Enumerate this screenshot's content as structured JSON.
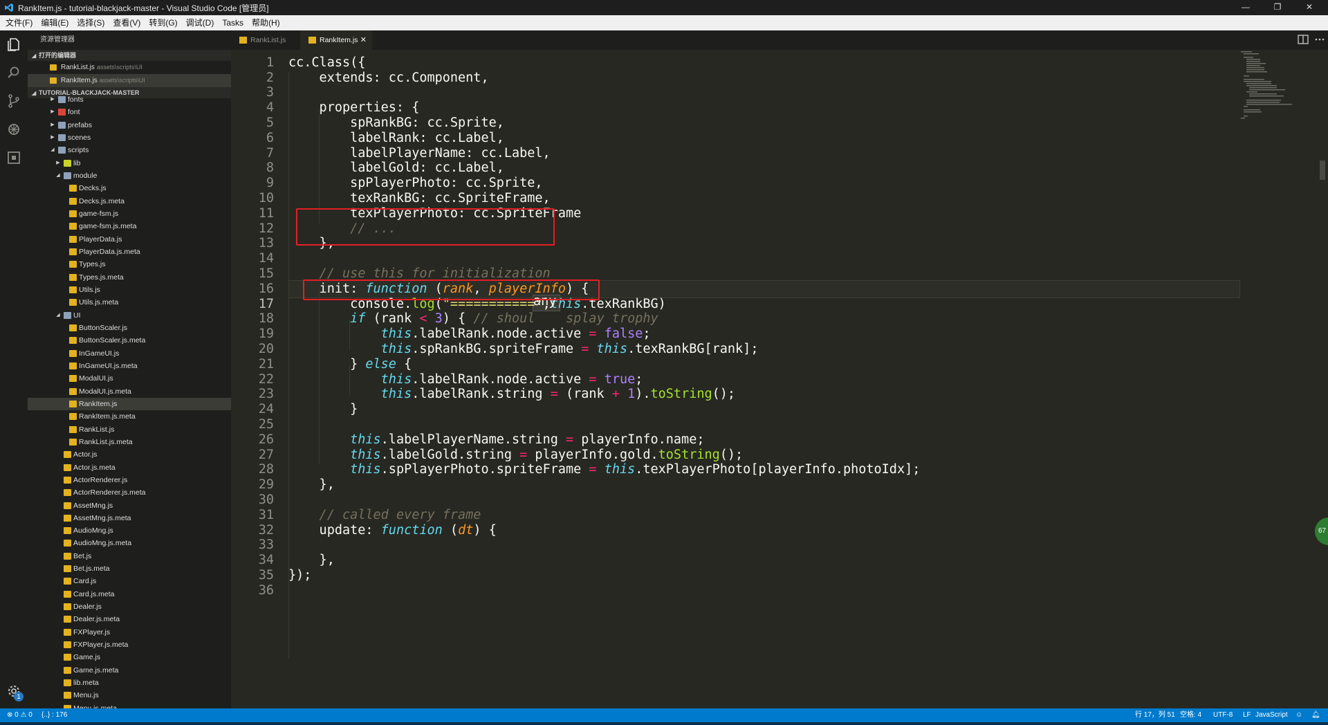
{
  "window": {
    "title": "RankItem.js - tutorial-blackjack-master - Visual Studio Code [管理员]",
    "controls": {
      "minimize": "—",
      "restore": "❐",
      "close": "✕"
    }
  },
  "menu": [
    "文件(F)",
    "编辑(E)",
    "选择(S)",
    "查看(V)",
    "转到(G)",
    "调试(D)",
    "Tasks",
    "帮助(H)"
  ],
  "activity_bar": {
    "icons": [
      "explorer-icon",
      "search-icon",
      "source-control-icon",
      "debug-icon",
      "extensions-icon",
      "settings-gear-icon"
    ],
    "settings_badge": "1"
  },
  "sidebar": {
    "title": "资源管理器",
    "open_editors_header": "打开的编辑器",
    "open_editors": [
      {
        "name": "RankList.js",
        "path": "assets\\scripts\\UI"
      },
      {
        "name": "RankItem.js",
        "path": "assets\\scripts\\UI"
      }
    ],
    "project_header": "TUTORIAL-BLACKJACK-MASTER",
    "tree": [
      {
        "label": "fonts",
        "type": "folder-partial",
        "depth": 2
      },
      {
        "label": "font",
        "type": "folder-red",
        "depth": 2
      },
      {
        "label": "prefabs",
        "type": "folder",
        "depth": 2
      },
      {
        "label": "scenes",
        "type": "folder",
        "depth": 2
      },
      {
        "label": "scripts",
        "type": "folder-open",
        "depth": 2
      },
      {
        "label": "lib",
        "type": "folder-lib",
        "depth": 3
      },
      {
        "label": "module",
        "type": "folder-open",
        "depth": 3
      },
      {
        "label": "Decks.js",
        "type": "js",
        "depth": 4
      },
      {
        "label": "Decks.js.meta",
        "type": "meta",
        "depth": 4
      },
      {
        "label": "game-fsm.js",
        "type": "js",
        "depth": 4
      },
      {
        "label": "game-fsm.js.meta",
        "type": "meta",
        "depth": 4
      },
      {
        "label": "PlayerData.js",
        "type": "js",
        "depth": 4
      },
      {
        "label": "PlayerData.js.meta",
        "type": "meta",
        "depth": 4
      },
      {
        "label": "Types.js",
        "type": "js",
        "depth": 4
      },
      {
        "label": "Types.js.meta",
        "type": "meta",
        "depth": 4
      },
      {
        "label": "Utils.js",
        "type": "js",
        "depth": 4
      },
      {
        "label": "Utils.js.meta",
        "type": "meta",
        "depth": 4
      },
      {
        "label": "UI",
        "type": "folder-open",
        "depth": 3
      },
      {
        "label": "ButtonScaler.js",
        "type": "js",
        "depth": 4
      },
      {
        "label": "ButtonScaler.js.meta",
        "type": "meta",
        "depth": 4
      },
      {
        "label": "InGameUI.js",
        "type": "js",
        "depth": 4
      },
      {
        "label": "InGameUI.js.meta",
        "type": "meta",
        "depth": 4
      },
      {
        "label": "ModalUI.js",
        "type": "js",
        "depth": 4
      },
      {
        "label": "ModalUI.js.meta",
        "type": "meta",
        "depth": 4
      },
      {
        "label": "RankItem.js",
        "type": "js",
        "depth": 4,
        "selected": true
      },
      {
        "label": "RankItem.js.meta",
        "type": "meta",
        "depth": 4
      },
      {
        "label": "RankList.js",
        "type": "js",
        "depth": 4
      },
      {
        "label": "RankList.js.meta",
        "type": "meta",
        "depth": 4
      },
      {
        "label": "Actor.js",
        "type": "js",
        "depth": 3
      },
      {
        "label": "Actor.js.meta",
        "type": "meta",
        "depth": 3
      },
      {
        "label": "ActorRenderer.js",
        "type": "js",
        "depth": 3
      },
      {
        "label": "ActorRenderer.js.meta",
        "type": "meta",
        "depth": 3
      },
      {
        "label": "AssetMng.js",
        "type": "js",
        "depth": 3
      },
      {
        "label": "AssetMng.js.meta",
        "type": "meta",
        "depth": 3
      },
      {
        "label": "AudioMng.js",
        "type": "js",
        "depth": 3
      },
      {
        "label": "AudioMng.js.meta",
        "type": "meta",
        "depth": 3
      },
      {
        "label": "Bet.js",
        "type": "js",
        "depth": 3
      },
      {
        "label": "Bet.js.meta",
        "type": "meta",
        "depth": 3
      },
      {
        "label": "Card.js",
        "type": "js",
        "depth": 3
      },
      {
        "label": "Card.js.meta",
        "type": "meta",
        "depth": 3
      },
      {
        "label": "Dealer.js",
        "type": "js",
        "depth": 3
      },
      {
        "label": "Dealer.js.meta",
        "type": "meta",
        "depth": 3
      },
      {
        "label": "FXPlayer.js",
        "type": "js",
        "depth": 3
      },
      {
        "label": "FXPlayer.js.meta",
        "type": "meta",
        "depth": 3
      },
      {
        "label": "Game.js",
        "type": "js",
        "depth": 3
      },
      {
        "label": "Game.js.meta",
        "type": "meta",
        "depth": 3
      },
      {
        "label": "lib.meta",
        "type": "meta",
        "depth": 3
      },
      {
        "label": "Menu.js",
        "type": "js",
        "depth": 3
      },
      {
        "label": "Menu.js.meta",
        "type": "meta",
        "depth": 3
      }
    ]
  },
  "tabs": [
    {
      "label": "RankList.js",
      "active": false
    },
    {
      "label": "RankItem.js",
      "active": true,
      "close": "✕"
    }
  ],
  "editor": {
    "current_line": 17,
    "hover_word": "any",
    "lines": [
      [
        [
          "",
          "cc.Class({"
        ]
      ],
      [
        [
          "",
          "    extends: cc.Component,"
        ]
      ],
      [
        [
          "",
          ""
        ]
      ],
      [
        [
          "",
          "    properties: {"
        ]
      ],
      [
        [
          "",
          "        spRankBG: cc.Sprite,"
        ]
      ],
      [
        [
          "",
          "        labelRank: cc.Label,"
        ]
      ],
      [
        [
          "",
          "        labelPlayerName: cc.Label,"
        ]
      ],
      [
        [
          "",
          "        labelGold: cc.Label,"
        ]
      ],
      [
        [
          "",
          "        spPlayerPhoto: cc.Sprite,"
        ]
      ],
      [
        [
          "",
          "        texRankBG: cc.SpriteFrame,"
        ]
      ],
      [
        [
          "",
          "        texPlayerPhoto: cc.SpriteFrame"
        ]
      ],
      [
        [
          "c",
          "        // ..."
        ]
      ],
      [
        [
          "",
          "    },"
        ]
      ],
      [
        [
          "",
          ""
        ]
      ],
      [
        [
          "c",
          "    // use this for initialization"
        ]
      ],
      [
        [
          "",
          "    init"
        ],
        [
          "",
          ": "
        ],
        [
          "i",
          "function"
        ],
        [
          "",
          " ("
        ],
        [
          "p",
          "rank"
        ],
        [
          "",
          ", "
        ],
        [
          "p",
          "playerInfo"
        ],
        [
          "",
          ") {"
        ]
      ],
      [
        [
          "",
          "        console."
        ],
        [
          "f",
          "log"
        ],
        [
          "",
          "("
        ],
        [
          "s",
          "\"===========\""
        ],
        [
          "",
          ","
        ],
        [
          "i",
          "this"
        ],
        [
          "",
          ".texRankBG)"
        ]
      ],
      [
        [
          "",
          "        "
        ],
        [
          "i",
          "if"
        ],
        [
          "",
          " (rank "
        ],
        [
          "k",
          "<"
        ],
        [
          "",
          " "
        ],
        [
          "n",
          "3"
        ],
        [
          "",
          ") { "
        ],
        [
          "c",
          "// shoul"
        ],
        [
          "",
          "    "
        ],
        [
          "c",
          "splay trophy"
        ]
      ],
      [
        [
          "",
          "            "
        ],
        [
          "i",
          "this"
        ],
        [
          "",
          ".labelRank.node.active "
        ],
        [
          "k",
          "="
        ],
        [
          "",
          " "
        ],
        [
          "n",
          "false"
        ],
        [
          "",
          ";"
        ]
      ],
      [
        [
          "",
          "            "
        ],
        [
          "i",
          "this"
        ],
        [
          "",
          ".spRankBG.spriteFrame "
        ],
        [
          "k",
          "="
        ],
        [
          "",
          " "
        ],
        [
          "i",
          "this"
        ],
        [
          "",
          ".texRankBG[rank];"
        ]
      ],
      [
        [
          "",
          "        } "
        ],
        [
          "i",
          "else"
        ],
        [
          "",
          " {"
        ]
      ],
      [
        [
          "",
          "            "
        ],
        [
          "i",
          "this"
        ],
        [
          "",
          ".labelRank.node.active "
        ],
        [
          "k",
          "="
        ],
        [
          "",
          " "
        ],
        [
          "n",
          "true"
        ],
        [
          "",
          ";"
        ]
      ],
      [
        [
          "",
          "            "
        ],
        [
          "i",
          "this"
        ],
        [
          "",
          ".labelRank.string "
        ],
        [
          "k",
          "="
        ],
        [
          "",
          " (rank "
        ],
        [
          "k",
          "+"
        ],
        [
          "",
          " "
        ],
        [
          "n",
          "1"
        ],
        [
          "",
          ")."
        ],
        [
          "f",
          "toString"
        ],
        [
          "",
          "();"
        ]
      ],
      [
        [
          "",
          "        }"
        ]
      ],
      [
        [
          "",
          ""
        ]
      ],
      [
        [
          "",
          "        "
        ],
        [
          "i",
          "this"
        ],
        [
          "",
          ".labelPlayerName.string "
        ],
        [
          "k",
          "="
        ],
        [
          "",
          " playerInfo.name;"
        ]
      ],
      [
        [
          "",
          "        "
        ],
        [
          "i",
          "this"
        ],
        [
          "",
          ".labelGold.string "
        ],
        [
          "k",
          "="
        ],
        [
          "",
          " playerInfo.gold."
        ],
        [
          "f",
          "toString"
        ],
        [
          "",
          "();"
        ]
      ],
      [
        [
          "",
          "        "
        ],
        [
          "i",
          "this"
        ],
        [
          "",
          ".spPlayerPhoto.spriteFrame "
        ],
        [
          "k",
          "="
        ],
        [
          "",
          " "
        ],
        [
          "i",
          "this"
        ],
        [
          "",
          ".texPlayerPhoto[playerInfo.photoIdx];"
        ]
      ],
      [
        [
          "",
          "    },"
        ]
      ],
      [
        [
          "",
          ""
        ]
      ],
      [
        [
          "c",
          "    // called every frame"
        ]
      ],
      [
        [
          "",
          "    update"
        ],
        [
          "",
          ": "
        ],
        [
          "i",
          "function"
        ],
        [
          "",
          " ("
        ],
        [
          "p",
          "dt"
        ],
        [
          "",
          ") {"
        ]
      ],
      [
        [
          "",
          ""
        ]
      ],
      [
        [
          "",
          "    },"
        ]
      ],
      [
        [
          "",
          "});"
        ]
      ],
      [
        [
          "",
          ""
        ]
      ]
    ]
  },
  "extension_badge": "67",
  "status": {
    "problems": "⊗ 0 ⚠ 0",
    "selection": "{..} : 176",
    "position": "行 17，列 51",
    "indent": "空格: 4",
    "encoding": "UTF-8",
    "eol": "LF",
    "language": "JavaScript"
  },
  "colors": {
    "editor_bg": "#272822",
    "sidebar_bg": "#1e1f1c",
    "status_bg": "#007acc",
    "highlight_box": "#e51e25"
  }
}
